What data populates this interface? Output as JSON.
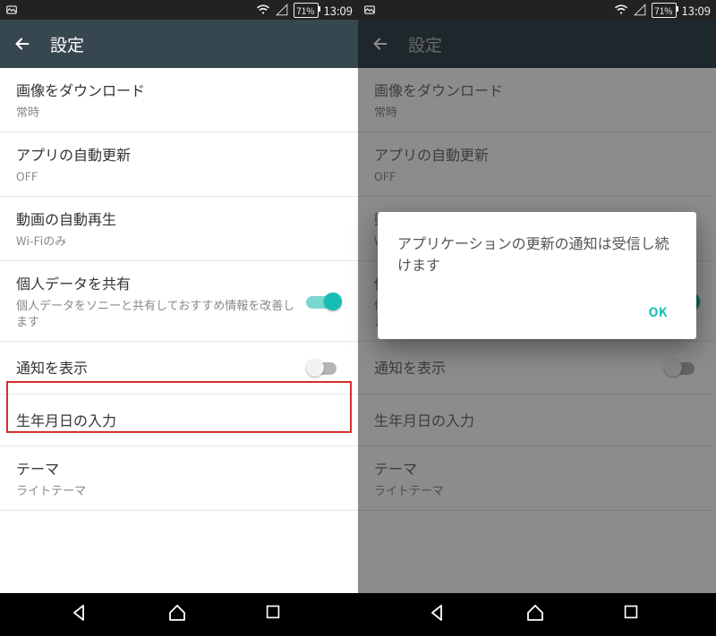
{
  "status": {
    "battery": "71%",
    "time": "13:09"
  },
  "toolbar": {
    "title": "設定"
  },
  "items": {
    "download": {
      "title": "画像をダウンロード",
      "sub": "常時"
    },
    "autoupdate": {
      "title": "アプリの自動更新",
      "sub": "OFF"
    },
    "autoplay": {
      "title": "動画の自動再生",
      "sub": "Wi-Fiのみ"
    },
    "share": {
      "title": "個人データを共有",
      "sub": "個人データをソニーと共有しておすすめ情報を改善します"
    },
    "notify": {
      "title": "通知を表示"
    },
    "birthday": {
      "title": "生年月日の入力"
    },
    "theme": {
      "title": "テーマ",
      "sub": "ライトテーマ"
    }
  },
  "dialog": {
    "message": "アプリケーションの更新の通知は受信し続けます",
    "ok": "OK"
  }
}
